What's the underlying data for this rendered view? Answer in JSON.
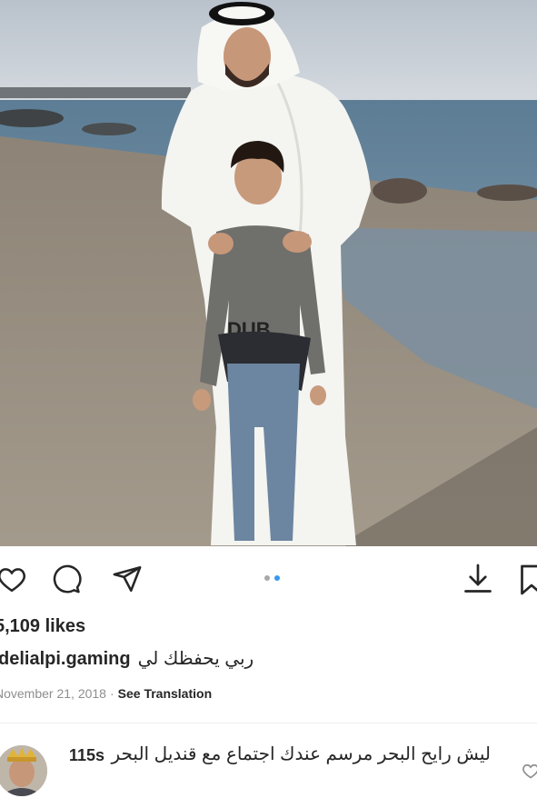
{
  "post": {
    "image_description_icon": "photo",
    "shirt_text": "DUB",
    "likes": "5,109 likes",
    "username": "delialpi.gaming",
    "caption": "ربي يحفظك لي",
    "date": "November 21, 2018",
    "separator": "·",
    "translate_label": "See Translation",
    "carousel": {
      "count": 2,
      "active_index": 0
    }
  },
  "actions": {
    "like_icon": "heart-icon",
    "comment_icon": "comment-icon",
    "share_icon": "send-icon",
    "download_icon": "download-icon",
    "save_icon": "bookmark-icon"
  },
  "comment": {
    "time": "115s",
    "text": "ليش رايح البحر مرسم عندك اجتماع مع قنديل البحر",
    "like_icon": "heart-icon"
  },
  "colors": {
    "text": "#262626",
    "muted": "#8e8e8e",
    "dot_active": "#3897f0",
    "dot_inactive": "#a8a8a8"
  }
}
